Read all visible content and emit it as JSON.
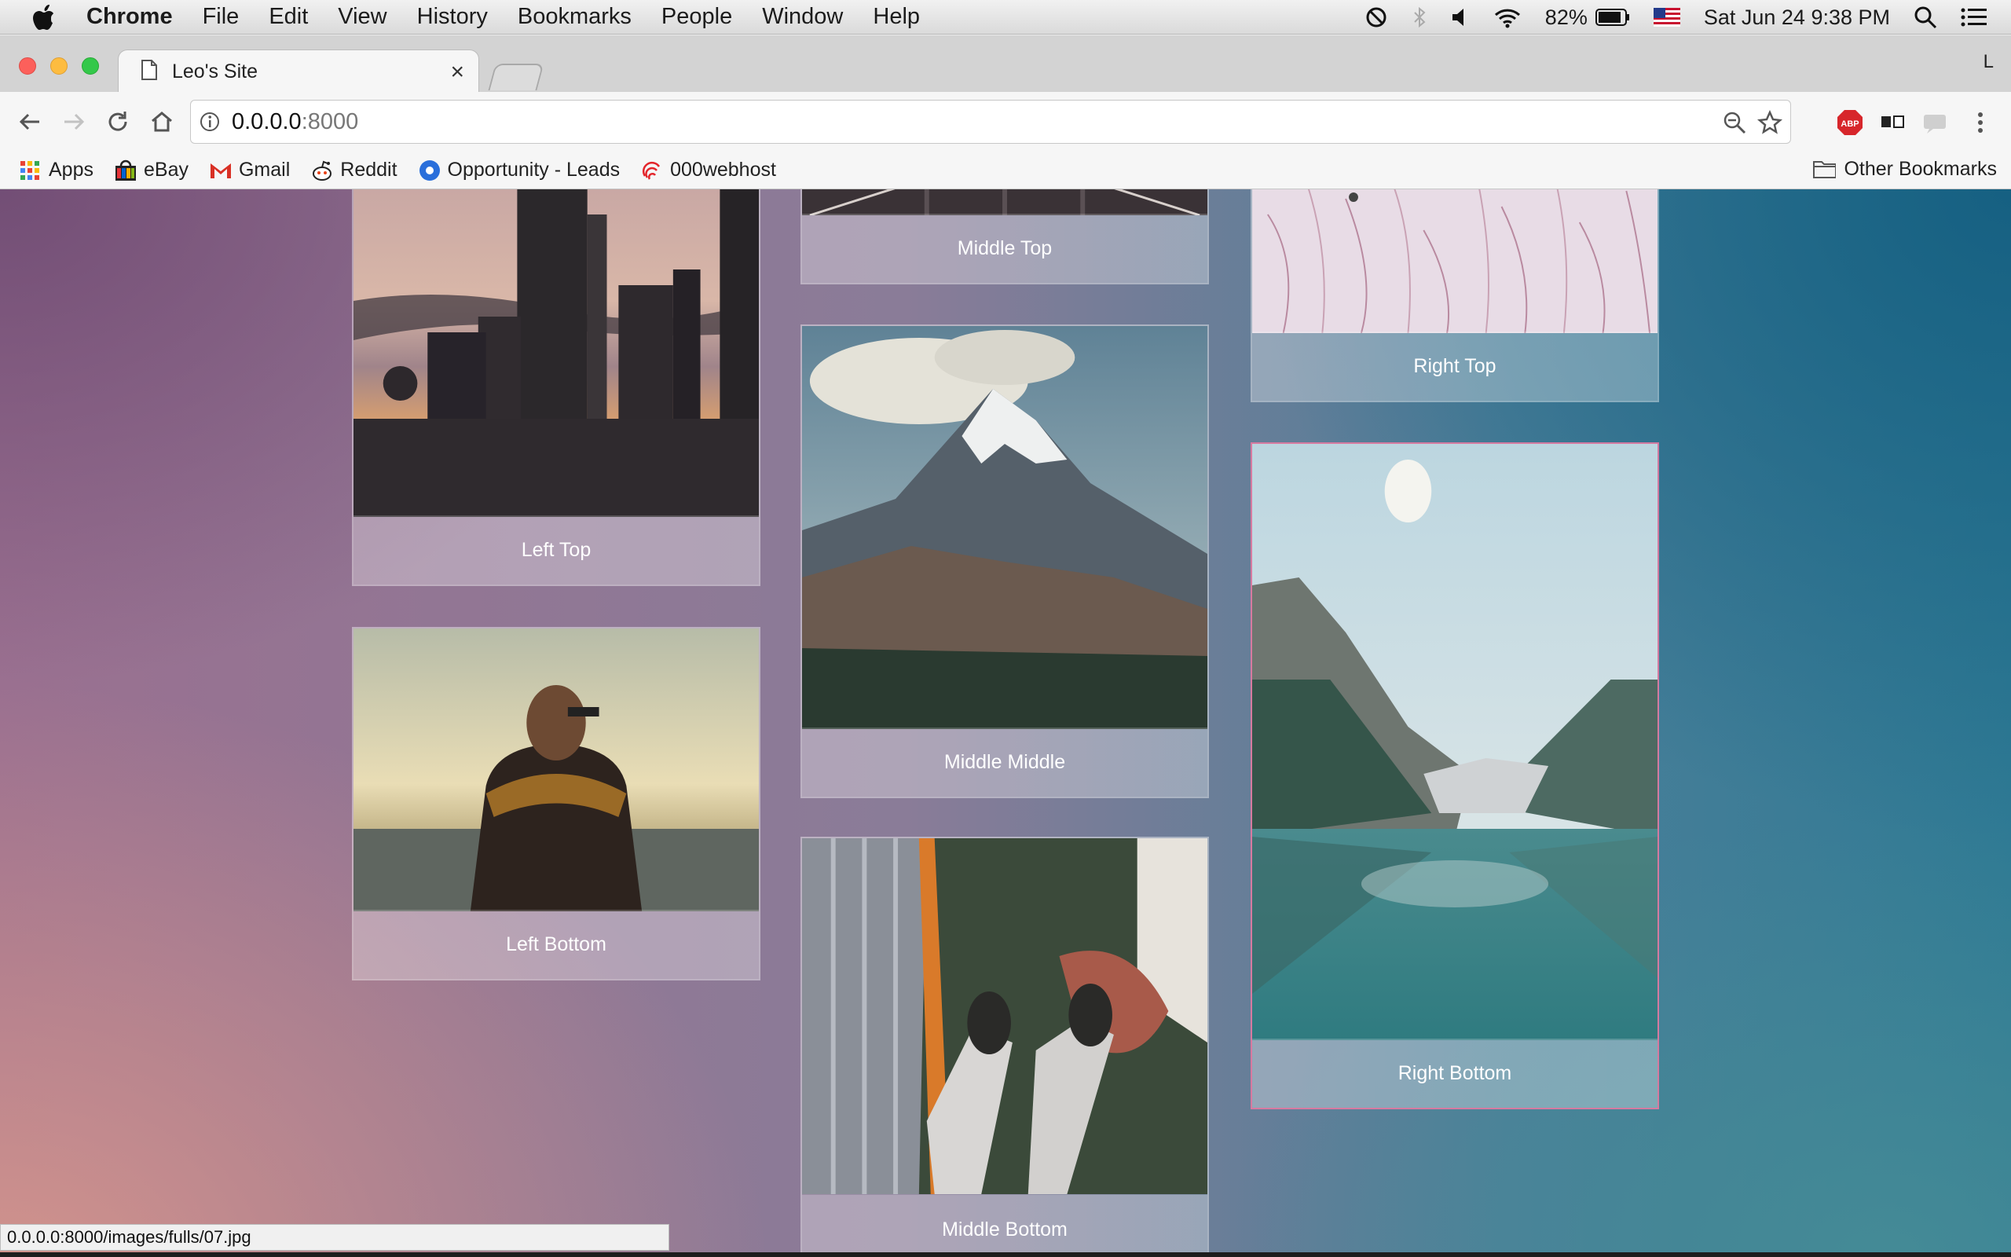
{
  "menubar": {
    "app": "Chrome",
    "items": [
      "File",
      "Edit",
      "View",
      "History",
      "Bookmarks",
      "People",
      "Window",
      "Help"
    ],
    "battery": "82%",
    "datetime": "Sat Jun 24  9:38 PM"
  },
  "tab": {
    "title": "Leo's Site",
    "close": "×"
  },
  "profile": "L",
  "address": {
    "host": "0.0.0.0",
    "port": ":8000"
  },
  "bookmarks": {
    "items": [
      "Apps",
      "eBay",
      "Gmail",
      "Reddit",
      "Opportunity - Leads",
      "000webhost"
    ],
    "other": "Other Bookmarks"
  },
  "gallery": {
    "left_top": "Left Top",
    "left_bottom": "Left Bottom",
    "middle_top": "Middle Top",
    "middle_middle": "Middle Middle",
    "middle_bottom": "Middle Bottom",
    "right_top": "Right Top",
    "right_bottom": "Right Bottom"
  },
  "status_url": "0.0.0.0:8000/images/fulls/07.jpg",
  "colors": {
    "highlight_border": "#e078a0",
    "close_red": "#fc605b",
    "minimize_yellow": "#fdbc40",
    "zoom_green": "#34c84a",
    "abp_red": "#d7262b"
  }
}
